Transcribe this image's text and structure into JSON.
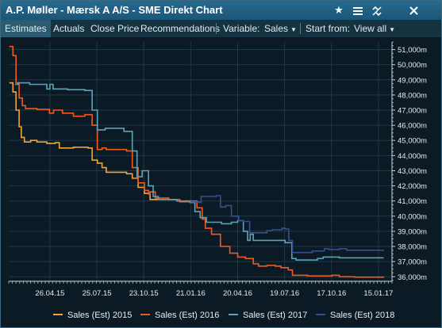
{
  "window": {
    "title": "A.P. Møller - Mærsk A A/S - SME Direkt Chart"
  },
  "titlebar_icons": [
    "star-icon",
    "menu-icon",
    "unlink-icon",
    "close-icon"
  ],
  "toolbar": {
    "tabs": [
      "Estimates",
      "Actuals",
      "Close Price",
      "Recommendations"
    ],
    "active_tab": "Estimates",
    "variable_label": "Variable:",
    "variable_value": "Sales",
    "start_label": "Start from:",
    "start_value": "View all"
  },
  "colors": {
    "title_bg": "#1f5f84",
    "toolbar_bg": "#14323f",
    "plot_bg": "#0b1a24",
    "grid": "#1b3542"
  },
  "chart_data": {
    "type": "line",
    "step": true,
    "grid": true,
    "legend_position": "bottom",
    "x_range": [
      "2015-02-06",
      "2017-02-10"
    ],
    "x_ticks": [
      {
        "date": "2015-04-26",
        "label": "26.04.15"
      },
      {
        "date": "2015-07-25",
        "label": "25.07.15"
      },
      {
        "date": "2015-10-23",
        "label": "23.10.15"
      },
      {
        "date": "2016-01-21",
        "label": "21.01.16"
      },
      {
        "date": "2016-04-20",
        "label": "20.04.16"
      },
      {
        "date": "2016-07-19",
        "label": "19.07.16"
      },
      {
        "date": "2016-10-17",
        "label": "17.10.16"
      },
      {
        "date": "2017-01-15",
        "label": "15.01.17"
      }
    ],
    "y_range": [
      35700,
      51500
    ],
    "y_ticks": [
      36000,
      37000,
      38000,
      39000,
      40000,
      41000,
      42000,
      43000,
      44000,
      45000,
      46000,
      47000,
      48000,
      49000,
      50000,
      51000
    ],
    "y_tick_labels": [
      "36,000m",
      "37,000m",
      "38,000m",
      "39,000m",
      "40,000m",
      "41,000m",
      "42,000m",
      "43,000m",
      "44,000m",
      "45,000m",
      "46,000m",
      "47,000m",
      "48,000m",
      "49,000m",
      "50,000m",
      "51,000m"
    ],
    "series": [
      {
        "name": "Sales (Est) 2015",
        "color": "#f0a53a",
        "points": [
          [
            "2015-02-07",
            48800
          ],
          [
            "2015-02-14",
            48200
          ],
          [
            "2015-02-20",
            47000
          ],
          [
            "2015-02-26",
            45900
          ],
          [
            "2015-03-02",
            45200
          ],
          [
            "2015-03-08",
            44900
          ],
          [
            "2015-03-20",
            45000
          ],
          [
            "2015-04-01",
            44900
          ],
          [
            "2015-04-20",
            44800
          ],
          [
            "2015-05-06",
            44850
          ],
          [
            "2015-05-14",
            44500
          ],
          [
            "2015-06-10",
            44550
          ],
          [
            "2015-07-08",
            44500
          ],
          [
            "2015-07-16",
            43700
          ],
          [
            "2015-07-26",
            43500
          ],
          [
            "2015-08-04",
            43200
          ],
          [
            "2015-08-12",
            42900
          ],
          [
            "2015-09-20",
            42800
          ],
          [
            "2015-10-01",
            42500
          ],
          [
            "2015-10-12",
            41900
          ],
          [
            "2015-10-24",
            41500
          ],
          [
            "2015-11-04",
            41100
          ],
          [
            "2015-12-20",
            41050
          ]
        ]
      },
      {
        "name": "Sales (Est) 2016",
        "color": "#ef5a22",
        "points": [
          [
            "2015-02-07",
            51200
          ],
          [
            "2015-02-14",
            50600
          ],
          [
            "2015-02-20",
            48800
          ],
          [
            "2015-02-26",
            47800
          ],
          [
            "2015-03-04",
            47300
          ],
          [
            "2015-03-10",
            47100
          ],
          [
            "2015-04-01",
            47050
          ],
          [
            "2015-04-25",
            46800
          ],
          [
            "2015-05-03",
            47000
          ],
          [
            "2015-05-20",
            46800
          ],
          [
            "2015-06-10",
            46600
          ],
          [
            "2015-07-02",
            46700
          ],
          [
            "2015-07-16",
            46000
          ],
          [
            "2015-07-26",
            44400
          ],
          [
            "2015-08-04",
            44500
          ],
          [
            "2015-08-12",
            44400
          ],
          [
            "2015-09-20",
            44300
          ],
          [
            "2015-10-01",
            43200
          ],
          [
            "2015-10-12",
            42200
          ],
          [
            "2015-10-24",
            41700
          ],
          [
            "2015-11-01",
            41450
          ],
          [
            "2015-11-04",
            41600
          ],
          [
            "2015-11-14",
            41200
          ],
          [
            "2015-12-10",
            41100
          ],
          [
            "2015-12-31",
            40950
          ],
          [
            "2016-01-20",
            41000
          ],
          [
            "2016-02-02",
            40550
          ],
          [
            "2016-02-12",
            39800
          ],
          [
            "2016-02-18",
            39200
          ],
          [
            "2016-03-01",
            38800
          ],
          [
            "2016-03-18",
            38000
          ],
          [
            "2016-04-05",
            37550
          ],
          [
            "2016-04-20",
            37300
          ],
          [
            "2016-05-05",
            37200
          ],
          [
            "2016-05-20",
            36850
          ],
          [
            "2016-05-30",
            36700
          ],
          [
            "2016-06-15",
            36750
          ],
          [
            "2016-07-01",
            36700
          ],
          [
            "2016-07-12",
            36600
          ],
          [
            "2016-07-26",
            36450
          ],
          [
            "2016-08-03",
            36100
          ],
          [
            "2016-09-01",
            36050
          ],
          [
            "2016-10-18",
            36100
          ],
          [
            "2016-11-01",
            36000
          ],
          [
            "2016-12-01",
            35970
          ],
          [
            "2017-01-25",
            35960
          ]
        ]
      },
      {
        "name": "Sales (Est) 2017",
        "color": "#5fa2b8",
        "points": [
          [
            "2015-02-18",
            48700
          ],
          [
            "2015-02-24",
            48800
          ],
          [
            "2015-03-18",
            48700
          ],
          [
            "2015-04-20",
            48400
          ],
          [
            "2015-04-26",
            48700
          ],
          [
            "2015-05-02",
            48400
          ],
          [
            "2015-05-30",
            48350
          ],
          [
            "2015-07-02",
            48300
          ],
          [
            "2015-07-16",
            47000
          ],
          [
            "2015-07-26",
            45700
          ],
          [
            "2015-08-10",
            45800
          ],
          [
            "2015-09-15",
            45600
          ],
          [
            "2015-10-01",
            44300
          ],
          [
            "2015-10-10",
            42600
          ],
          [
            "2015-10-20",
            43000
          ],
          [
            "2015-11-01",
            42000
          ],
          [
            "2015-11-10",
            41300
          ],
          [
            "2015-11-20",
            41100
          ],
          [
            "2015-12-25",
            41000
          ],
          [
            "2016-01-20",
            40900
          ],
          [
            "2016-01-29",
            40300
          ],
          [
            "2016-02-08",
            39900
          ],
          [
            "2016-02-20",
            39600
          ],
          [
            "2016-03-20",
            39500
          ],
          [
            "2016-04-08",
            39600
          ],
          [
            "2016-04-20",
            39700
          ],
          [
            "2016-05-01",
            39000
          ],
          [
            "2016-05-09",
            38400
          ],
          [
            "2016-05-14",
            38800
          ],
          [
            "2016-05-20",
            38400
          ],
          [
            "2016-07-01",
            38400
          ],
          [
            "2016-07-20",
            38250
          ],
          [
            "2016-08-02",
            37200
          ],
          [
            "2016-08-10",
            37100
          ],
          [
            "2016-09-20",
            37200
          ],
          [
            "2016-10-01",
            37300
          ],
          [
            "2016-11-01",
            37250
          ],
          [
            "2017-01-25",
            37250
          ]
        ]
      },
      {
        "name": "Sales (Est) 2018",
        "color": "#34508e",
        "points": [
          [
            "2016-01-20",
            40950
          ],
          [
            "2016-02-06",
            40900
          ],
          [
            "2016-02-10",
            41300
          ],
          [
            "2016-03-10",
            41350
          ],
          [
            "2016-03-18",
            40600
          ],
          [
            "2016-03-28",
            40700
          ],
          [
            "2016-04-08",
            40000
          ],
          [
            "2016-04-22",
            39700
          ],
          [
            "2016-05-01",
            39650
          ],
          [
            "2016-05-13",
            38900
          ],
          [
            "2016-06-05",
            38900
          ],
          [
            "2016-06-15",
            39050
          ],
          [
            "2016-06-25",
            39100
          ],
          [
            "2016-07-14",
            39200
          ],
          [
            "2016-07-20",
            39150
          ],
          [
            "2016-07-27",
            38400
          ],
          [
            "2016-08-03",
            37600
          ],
          [
            "2016-09-10",
            37700
          ],
          [
            "2016-10-03",
            37850
          ],
          [
            "2016-10-12",
            37800
          ],
          [
            "2016-11-01",
            37850
          ],
          [
            "2016-11-15",
            37750
          ],
          [
            "2017-01-25",
            37760
          ]
        ]
      }
    ]
  }
}
